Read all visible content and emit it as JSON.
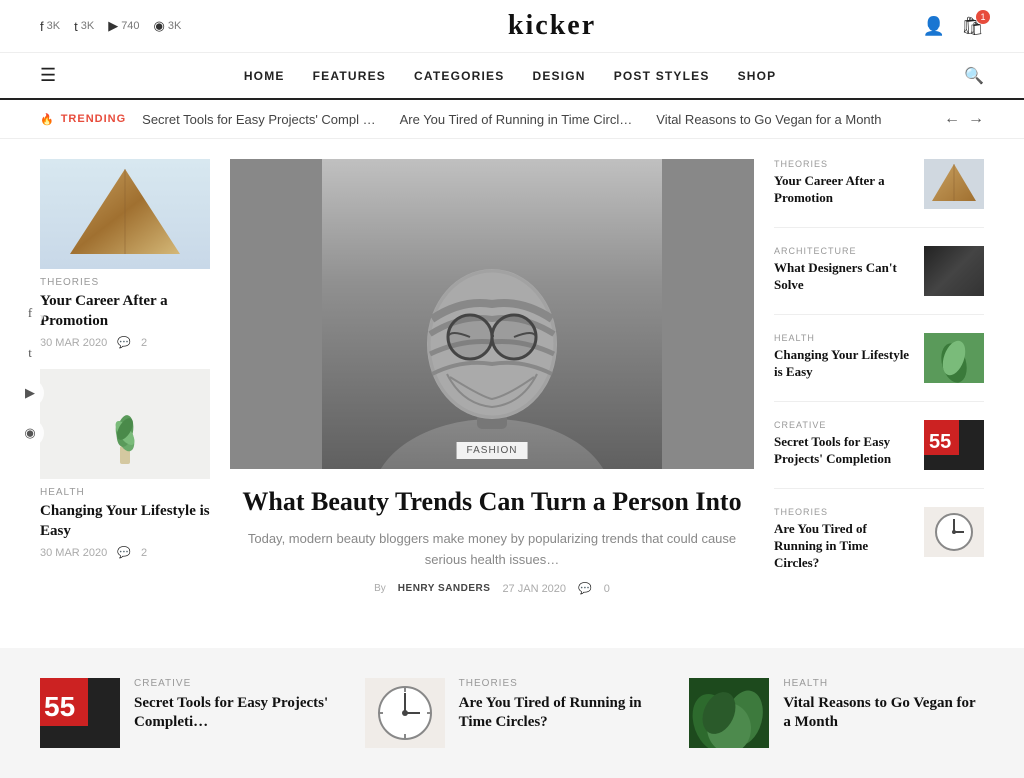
{
  "logo": "kicker",
  "topbar": {
    "social": [
      {
        "platform": "facebook",
        "icon": "f",
        "count": "3K"
      },
      {
        "platform": "twitter",
        "icon": "t",
        "count": "3K"
      },
      {
        "platform": "youtube",
        "icon": "▶",
        "count": "740"
      },
      {
        "platform": "instagram",
        "icon": "◉",
        "count": "3K"
      }
    ],
    "cart_count": "1"
  },
  "nav": {
    "links": [
      "HOME",
      "FEATURES",
      "CATEGORIES",
      "DESIGN",
      "POST STYLES",
      "SHOP"
    ]
  },
  "trending": {
    "label": "TRENDING",
    "items": [
      "Secret Tools for Easy Projects' Compl …",
      "Are You Tired of Running in Time Circl…",
      "Vital Reasons to Go Vegan for a Month"
    ]
  },
  "left_articles": [
    {
      "category": "THEORIES",
      "title": "Your Career After a Promotion",
      "date": "30 MAR 2020",
      "comments": "2",
      "img_type": "triangle"
    },
    {
      "category": "HEALTH",
      "title": "Changing Your Lifestyle is Easy",
      "date": "30 MAR 2020",
      "comments": "2",
      "img_type": "plant"
    }
  ],
  "featured": {
    "category": "FASHION",
    "title": "What Beauty Trends Can Turn a Person Into",
    "excerpt": "Today, modern beauty bloggers make money by popularizing trends that could cause serious health issues…",
    "author": "HENRY SANDERS",
    "date": "27 JAN 2020",
    "comments": "0"
  },
  "right_articles": [
    {
      "category": "THEORIES",
      "title": "Your Career After a Promotion",
      "img_type": "wood"
    },
    {
      "category": "ARCHITECTURE",
      "title": "What Designers Can't Solve",
      "img_type": "dark"
    },
    {
      "category": "HEALTH",
      "title": "Changing Your Lifestyle is Easy",
      "img_type": "green"
    },
    {
      "category": "CREATIVE",
      "title": "Secret Tools for Easy Projects' Completion",
      "img_type": "red"
    },
    {
      "category": "THEORIES",
      "title": "Are You Tired of Running in Time Circles?",
      "img_type": "clock"
    }
  ],
  "bottom_cards": [
    {
      "category": "CREATIVE",
      "title": "Secret Tools for Easy Projects' Completi…",
      "img_type": "red"
    },
    {
      "category": "THEORIES",
      "title": "Are You Tired of Running in Time Circles?",
      "img_type": "clock"
    },
    {
      "category": "HEALTH",
      "title": "Vital Reasons to Go Vegan for a Month",
      "img_type": "green"
    }
  ],
  "social_sidebar": [
    "f",
    "t",
    "▶",
    "◉"
  ],
  "colors": {
    "accent": "#e74c3c",
    "text_dark": "#111",
    "text_light": "#aaa"
  }
}
